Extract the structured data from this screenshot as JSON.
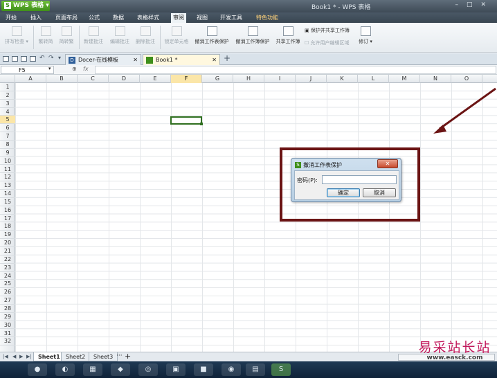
{
  "app": {
    "logo": "S",
    "name": "WPS 表格",
    "window_title": "Book1 * - WPS 表格",
    "window_controls": [
      "–",
      "□",
      "✕"
    ]
  },
  "menu": {
    "items": [
      "开始",
      "插入",
      "页面布局",
      "公式",
      "数据",
      "表格样式",
      "审阅",
      "视图",
      "开发工具",
      "特色功能"
    ],
    "active": "审阅"
  },
  "ribbon": {
    "spellcheck": "拼写检查",
    "trad_to_simp": "繁转简",
    "simp_to_trad": "简转繁",
    "new_comment": "新建批注",
    "edit_comment": "编辑批注",
    "delete_comment": "删除批注",
    "lock_cell": "锁定单元格",
    "unprotect_sheet": "撤消工作表保护",
    "unprotect_workbook": "撤消工作簿保护",
    "share_workbook": "共享工作簿",
    "protect_share": "保护并共享工作簿",
    "allow_edit_ranges": "允许用户编辑区域",
    "track_changes": "修订"
  },
  "doc_tabs": [
    {
      "label": "Docer-在线模板",
      "active": false
    },
    {
      "label": "Book1 *",
      "active": true
    }
  ],
  "formula_bar": {
    "name_box": "F5",
    "fx": "fx",
    "value": ""
  },
  "grid": {
    "columns": [
      "A",
      "B",
      "C",
      "D",
      "E",
      "F",
      "G",
      "H",
      "I",
      "J",
      "K",
      "L",
      "M",
      "N",
      "O"
    ],
    "rows": [
      "1",
      "2",
      "3",
      "4",
      "5",
      "6",
      "7",
      "8",
      "9",
      "10",
      "11",
      "12",
      "13",
      "14",
      "15",
      "16",
      "17",
      "18",
      "19",
      "20",
      "21",
      "22",
      "23",
      "24",
      "25",
      "26",
      "27",
      "28",
      "29",
      "30",
      "31",
      "32"
    ],
    "selected_column": "F",
    "selected_row": "5"
  },
  "sheets": {
    "tabs": [
      "Sheet1",
      "Sheet2",
      "Sheet3"
    ],
    "active": "Sheet1",
    "more": "···",
    "add": "+"
  },
  "dialog": {
    "title": "撤消工作表保护",
    "close": "✕",
    "password_label": "密码(P):",
    "password_value": "",
    "ok": "确定",
    "cancel": "取消"
  },
  "watermark": {
    "title": "易采站长站",
    "url": "www.easck.com"
  },
  "colors": {
    "annotation": "#6b1414",
    "selection": "#2f6f1f",
    "header_highlight": "#fbe6a8"
  }
}
